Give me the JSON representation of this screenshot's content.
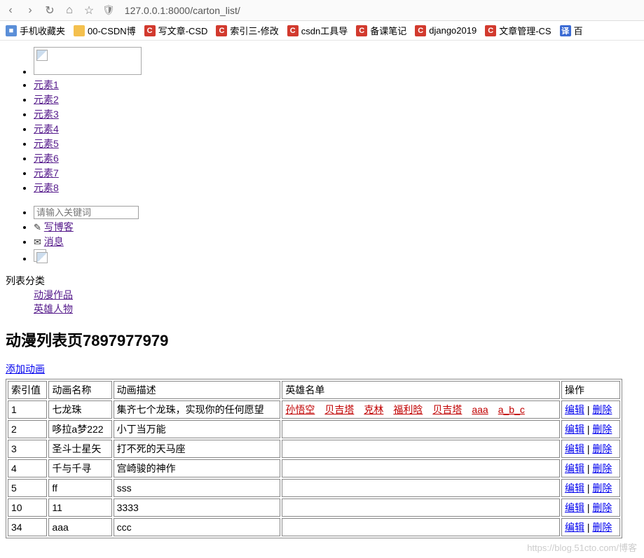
{
  "browser": {
    "url": "127.0.0.1:8000/carton_list/",
    "bookmarks": [
      {
        "label": "手机收藏夹",
        "icon": "ic-blue"
      },
      {
        "label": "00-CSDN博",
        "icon": "ic-folder"
      },
      {
        "label": "写文章-CSD",
        "icon": "ic-red"
      },
      {
        "label": "索引三-修改",
        "icon": "ic-red"
      },
      {
        "label": "csdn工具导",
        "icon": "ic-red"
      },
      {
        "label": "备课笔记",
        "icon": "ic-red"
      },
      {
        "label": "django2019",
        "icon": "ic-red"
      },
      {
        "label": "文章管理-CS",
        "icon": "ic-red"
      },
      {
        "label": "百",
        "icon": "ic-bluef"
      }
    ]
  },
  "nav_items": [
    "元素1",
    "元素2",
    "元素3",
    "元素4",
    "元素5",
    "元素6",
    "元素7",
    "元素8"
  ],
  "search": {
    "placeholder": "请输入关键词"
  },
  "write_blog": "写博客",
  "messages": "消息",
  "category": {
    "title": "列表分类",
    "items": [
      "动漫作品",
      "英雄人物"
    ]
  },
  "page_heading": "动漫列表页7897977979",
  "add_link": "添加动画",
  "table": {
    "headers": [
      "索引值",
      "动画名称",
      "动画描述",
      "英雄名单",
      "操作"
    ],
    "ops": {
      "edit": "编辑",
      "delete": "删除"
    },
    "rows": [
      {
        "idx": "1",
        "name": "七龙珠",
        "desc": "集齐七个龙珠，实现你的任何愿望",
        "heroes": [
          "孙悟空",
          "贝吉塔",
          "克林",
          "福利晗",
          "贝吉塔",
          "aaa",
          "a_b_c"
        ]
      },
      {
        "idx": "2",
        "name": "哆拉a梦222",
        "desc": "小丁当万能",
        "heroes": []
      },
      {
        "idx": "3",
        "name": "圣斗士星矢",
        "desc": "打不死的天马座",
        "heroes": []
      },
      {
        "idx": "4",
        "name": "千与千寻",
        "desc": "宫崎骏的神作",
        "heroes": []
      },
      {
        "idx": "5",
        "name": "ff",
        "desc": "sss",
        "heroes": []
      },
      {
        "idx": "10",
        "name": "11",
        "desc": "3333",
        "heroes": []
      },
      {
        "idx": "34",
        "name": "aaa",
        "desc": "ccc",
        "heroes": []
      }
    ]
  },
  "watermark": "https://blog.51cto.com/博客"
}
